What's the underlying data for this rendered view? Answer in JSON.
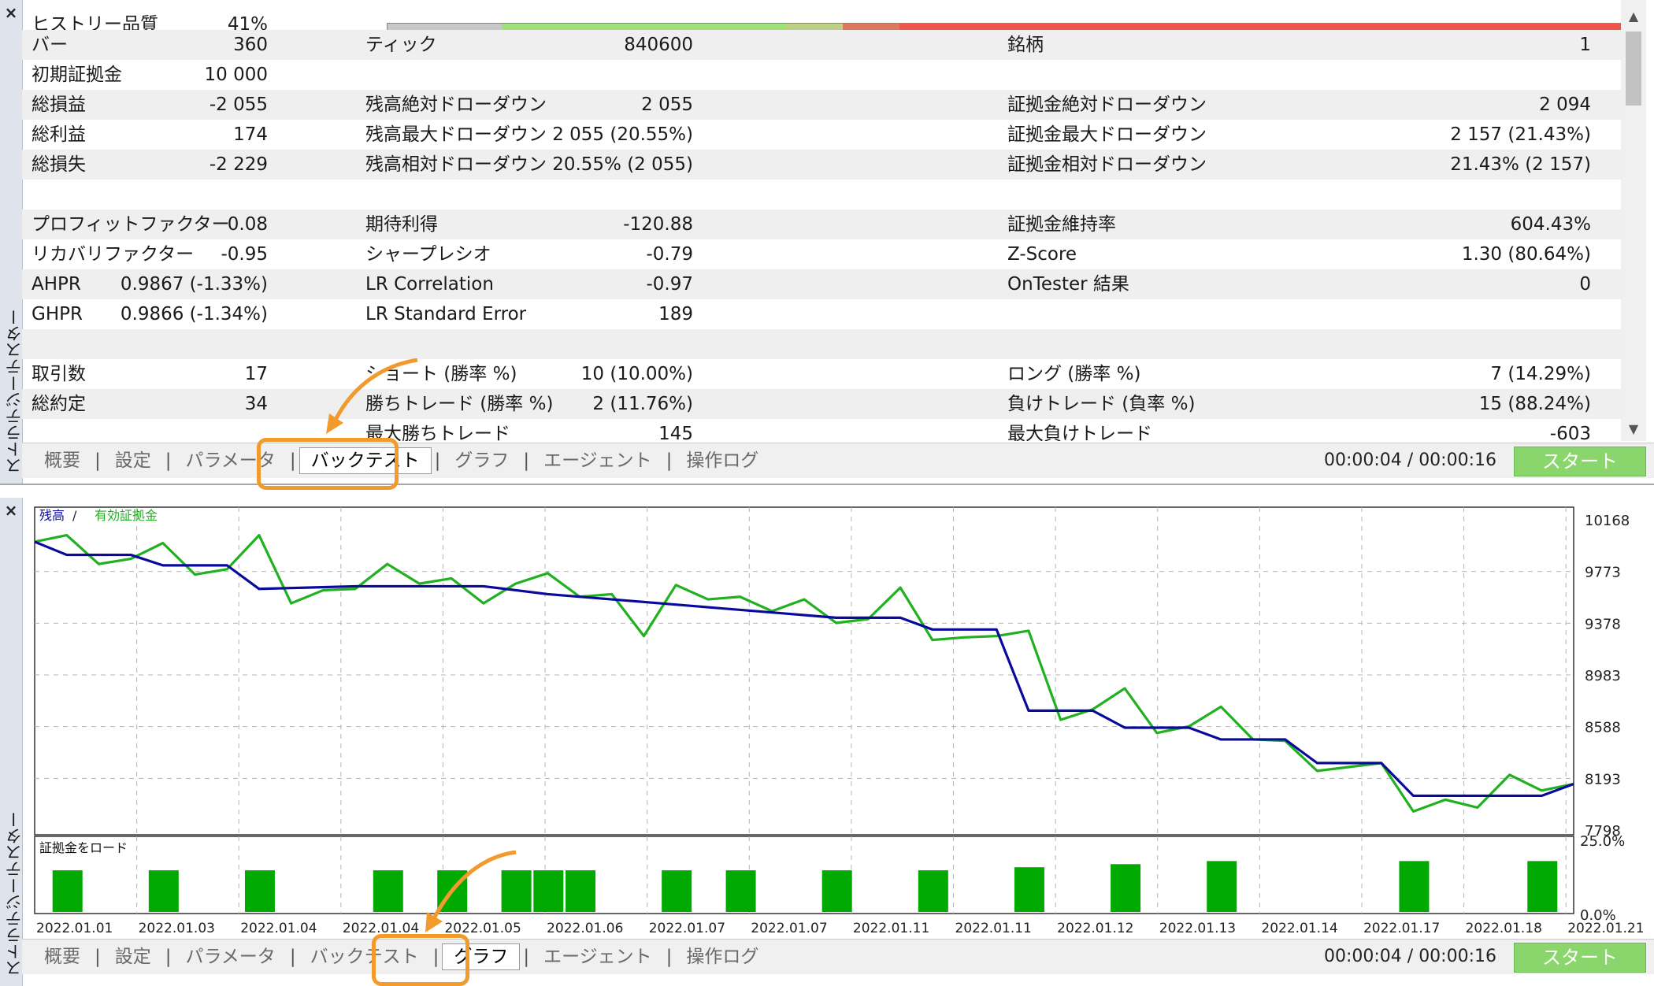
{
  "panel_title": "ストラテジーテスター",
  "close_glyph": "×",
  "quality": {
    "label": "ヒストリー品質",
    "value": "41%",
    "segments": [
      "#c8c8c8",
      "#c8c8c8",
      "#a2e07a",
      "#a2e07a",
      "#a2e07a",
      "#a2e07a",
      "#a2e07a",
      "#bdd184",
      "#d97a5a",
      "#ee5549",
      "#ee5549",
      "#ee5549",
      "#ee5549",
      "#ee5549",
      "#ee5549",
      "#ee5549",
      "#ee5549",
      "#ee5549",
      "#ee5549",
      "#ee5549",
      "#ee5549",
      "#ee5549"
    ]
  },
  "report_rows": [
    {
      "l1": "バー",
      "v1": "360",
      "l2": "ティック",
      "v2": "840600",
      "l3": "銘柄",
      "v3": "1"
    },
    {
      "l1": "初期証拠金",
      "v1": "10 000",
      "l2": "",
      "v2": "",
      "l3": "",
      "v3": ""
    },
    {
      "l1": "総損益",
      "v1": "-2 055",
      "l2": "残高絶対ドローダウン",
      "v2": "2 055",
      "l3": "証拠金絶対ドローダウン",
      "v3": "2 094"
    },
    {
      "l1": "総利益",
      "v1": "174",
      "l2": "残高最大ドローダウン",
      "v2": "2 055 (20.55%)",
      "l3": "証拠金最大ドローダウン",
      "v3": "2 157 (21.43%)"
    },
    {
      "l1": "総損失",
      "v1": "-2 229",
      "l2": "残高相対ドローダウン",
      "v2": "20.55% (2 055)",
      "l3": "証拠金相対ドローダウン",
      "v3": "21.43% (2 157)"
    },
    {
      "l1": "",
      "v1": "",
      "l2": "",
      "v2": "",
      "l3": "",
      "v3": ""
    },
    {
      "l1": "プロフィットファクター",
      "v1": "0.08",
      "l2": "期待利得",
      "v2": "-120.88",
      "l3": "証拠金維持率",
      "v3": "604.43%"
    },
    {
      "l1": "リカバリファクター",
      "v1": "-0.95",
      "l2": "シャープレシオ",
      "v2": "-0.79",
      "l3": "Z-Score",
      "v3": "1.30 (80.64%)"
    },
    {
      "l1": "AHPR",
      "v1": "0.9867 (-1.33%)",
      "l2": "LR Correlation",
      "v2": "-0.97",
      "l3": "OnTester 結果",
      "v3": "0"
    },
    {
      "l1": "GHPR",
      "v1": "0.9866 (-1.34%)",
      "l2": "LR Standard Error",
      "v2": "189",
      "l3": "",
      "v3": ""
    },
    {
      "l1": "",
      "v1": "",
      "l2": "",
      "v2": "",
      "l3": "",
      "v3": ""
    },
    {
      "l1": "取引数",
      "v1": "17",
      "l2": "ショート (勝率 %)",
      "v2": "10 (10.00%)",
      "l3": "ロング (勝率 %)",
      "v3": "7 (14.29%)"
    },
    {
      "l1": "総約定",
      "v1": "34",
      "l2": "勝ちトレード (勝率 %)",
      "v2": "2 (11.76%)",
      "l3": "負けトレード (負率 %)",
      "v3": "15 (88.24%)"
    },
    {
      "l1": "",
      "v1": "",
      "l2": "最大勝ちトレード",
      "v2": "145",
      "l3": "最大負けトレード",
      "v3": "-603"
    }
  ],
  "tabs_top": [
    "概要",
    "設定",
    "パラメータ",
    "バックテスト",
    "グラフ",
    "エージェント",
    "操作ログ"
  ],
  "tabs_bottom": [
    "概要",
    "設定",
    "パラメータ",
    "バックテスト",
    "グラフ",
    "エージェント",
    "操作ログ"
  ],
  "active_tab_top": 3,
  "active_tab_bottom": 4,
  "timer": "00:00:04 / 00:00:16",
  "start_label": "スタート",
  "colors": {
    "accent": "#f39a2d",
    "balance": "#0a0a9a",
    "equity": "#20b020",
    "load": "#00aa00",
    "start": "#8bd66c"
  },
  "chart_data": {
    "type": "line",
    "legend": {
      "balance": "残高",
      "sep": " / ",
      "equity": "有効証拠金",
      "position": "top-left"
    },
    "ylabels": [
      "10168",
      "9773",
      "9378",
      "8983",
      "8588",
      "8193",
      "7798"
    ],
    "ylim": [
      7798,
      10168
    ],
    "x_labels": [
      "2022.01.01",
      "2022.01.03",
      "2022.01.04",
      "2022.01.04",
      "2022.01.05",
      "2022.01.06",
      "2022.01.07",
      "2022.01.07",
      "2022.01.11",
      "2022.01.11",
      "2022.01.12",
      "2022.01.13",
      "2022.01.14",
      "2022.01.17",
      "2022.01.18",
      "2022.01.21"
    ],
    "grid": true,
    "series": [
      {
        "name": "残高",
        "values": [
          [
            0,
            10000
          ],
          [
            1,
            9900
          ],
          [
            3,
            9900
          ],
          [
            4,
            9820
          ],
          [
            6,
            9820
          ],
          [
            7,
            9640
          ],
          [
            10,
            9660
          ],
          [
            14,
            9660
          ],
          [
            16,
            9600
          ],
          [
            18,
            9560
          ],
          [
            21,
            9500
          ],
          [
            25,
            9420
          ],
          [
            27,
            9420
          ],
          [
            28,
            9330
          ],
          [
            30,
            9330
          ],
          [
            31,
            8710
          ],
          [
            33,
            8710
          ],
          [
            34,
            8580
          ],
          [
            36,
            8580
          ],
          [
            37,
            8490
          ],
          [
            39,
            8490
          ],
          [
            40,
            8310
          ],
          [
            42,
            8310
          ],
          [
            43,
            8060
          ],
          [
            46,
            8060
          ],
          [
            47,
            8060
          ],
          [
            48,
            8150
          ]
        ]
      },
      {
        "name": "有効証拠金",
        "values": [
          [
            0,
            10000
          ],
          [
            1,
            10050
          ],
          [
            2,
            9830
          ],
          [
            3,
            9870
          ],
          [
            4,
            9990
          ],
          [
            5,
            9750
          ],
          [
            6,
            9790
          ],
          [
            7,
            10050
          ],
          [
            8,
            9530
          ],
          [
            9,
            9630
          ],
          [
            10,
            9640
          ],
          [
            11,
            9830
          ],
          [
            12,
            9680
          ],
          [
            13,
            9720
          ],
          [
            14,
            9530
          ],
          [
            15,
            9680
          ],
          [
            16,
            9760
          ],
          [
            17,
            9580
          ],
          [
            18,
            9600
          ],
          [
            19,
            9280
          ],
          [
            20,
            9670
          ],
          [
            21,
            9560
          ],
          [
            22,
            9580
          ],
          [
            23,
            9470
          ],
          [
            24,
            9560
          ],
          [
            25,
            9380
          ],
          [
            26,
            9410
          ],
          [
            27,
            9650
          ],
          [
            28,
            9250
          ],
          [
            29,
            9270
          ],
          [
            30,
            9280
          ],
          [
            31,
            9320
          ],
          [
            32,
            8640
          ],
          [
            33,
            8720
          ],
          [
            34,
            8880
          ],
          [
            35,
            8540
          ],
          [
            36,
            8590
          ],
          [
            37,
            8740
          ],
          [
            38,
            8490
          ],
          [
            39,
            8480
          ],
          [
            40,
            8250
          ],
          [
            41,
            8280
          ],
          [
            42,
            8310
          ],
          [
            43,
            7940
          ],
          [
            44,
            8030
          ],
          [
            45,
            7970
          ],
          [
            46,
            8220
          ],
          [
            47,
            8100
          ],
          [
            48,
            8150
          ]
        ]
      }
    ],
    "sub_chart": {
      "label": "証拠金をロード",
      "ylabels": [
        "25.0%",
        "0.0%"
      ],
      "bars": [
        {
          "x": 1,
          "v": 14
        },
        {
          "x": 4,
          "v": 14
        },
        {
          "x": 7,
          "v": 14
        },
        {
          "x": 11,
          "v": 14
        },
        {
          "x": 13,
          "v": 14
        },
        {
          "x": 15,
          "v": 14
        },
        {
          "x": 16,
          "v": 14
        },
        {
          "x": 17,
          "v": 14
        },
        {
          "x": 20,
          "v": 14
        },
        {
          "x": 22,
          "v": 14
        },
        {
          "x": 25,
          "v": 14
        },
        {
          "x": 28,
          "v": 14
        },
        {
          "x": 31,
          "v": 15
        },
        {
          "x": 34,
          "v": 16
        },
        {
          "x": 37,
          "v": 17
        },
        {
          "x": 43,
          "v": 17
        },
        {
          "x": 47,
          "v": 17
        }
      ]
    }
  }
}
